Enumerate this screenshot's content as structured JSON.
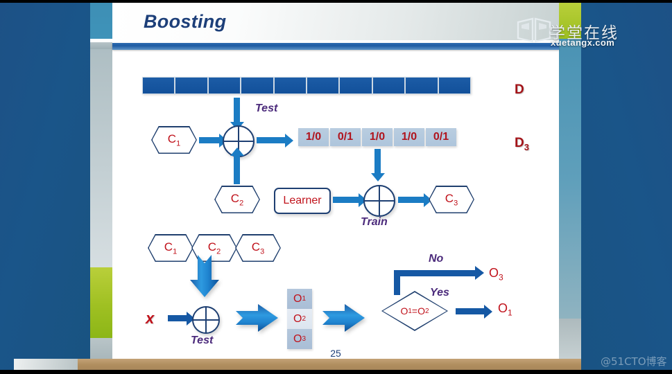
{
  "slide": {
    "title": "Boosting",
    "page_number": "25"
  },
  "logo": {
    "icon": "open-book-icon",
    "chinese": "学堂在线",
    "domain": "xuetangx.com"
  },
  "watermark": "@51CTO博客",
  "diagram": {
    "dataset_bar": {
      "label": "D",
      "segment_count": 10,
      "segment_color": "#1c5ca6"
    },
    "weighted_row": {
      "label": "D",
      "label_sub": "3",
      "cells": [
        "1/0",
        "0/1",
        "1/0",
        "1/0",
        "0/1"
      ],
      "cell_color": "#b9cde0",
      "text_color": "#b0141d"
    },
    "classifiers": {
      "c1": "C",
      "c1_sub": "1",
      "c2": "C",
      "c2_sub": "2",
      "c3": "C",
      "c3_sub": "3"
    },
    "learner_label": "Learner",
    "test_label_top": "Test",
    "train_label": "Train",
    "test_label_bottom": "Test",
    "input_label": "x",
    "outputs": {
      "o1": "O",
      "o1_sub": "1",
      "o2": "O",
      "o2_sub": "2",
      "o3": "O",
      "o3_sub": "3"
    },
    "decision": {
      "condition": "O",
      "condition_sub1": "1",
      "condition_eq": "=O",
      "condition_sub2": "2",
      "branch_no": "No",
      "branch_no_result": "O",
      "branch_no_result_sub": "3",
      "branch_yes": "Yes",
      "branch_yes_result": "O",
      "branch_yes_result_sub": "1"
    }
  },
  "colors": {
    "title": "#1d3f79",
    "accent_red": "#c0121b",
    "accent_blue": "#1b7cc4",
    "italic_purple": "#4b2a7b"
  }
}
